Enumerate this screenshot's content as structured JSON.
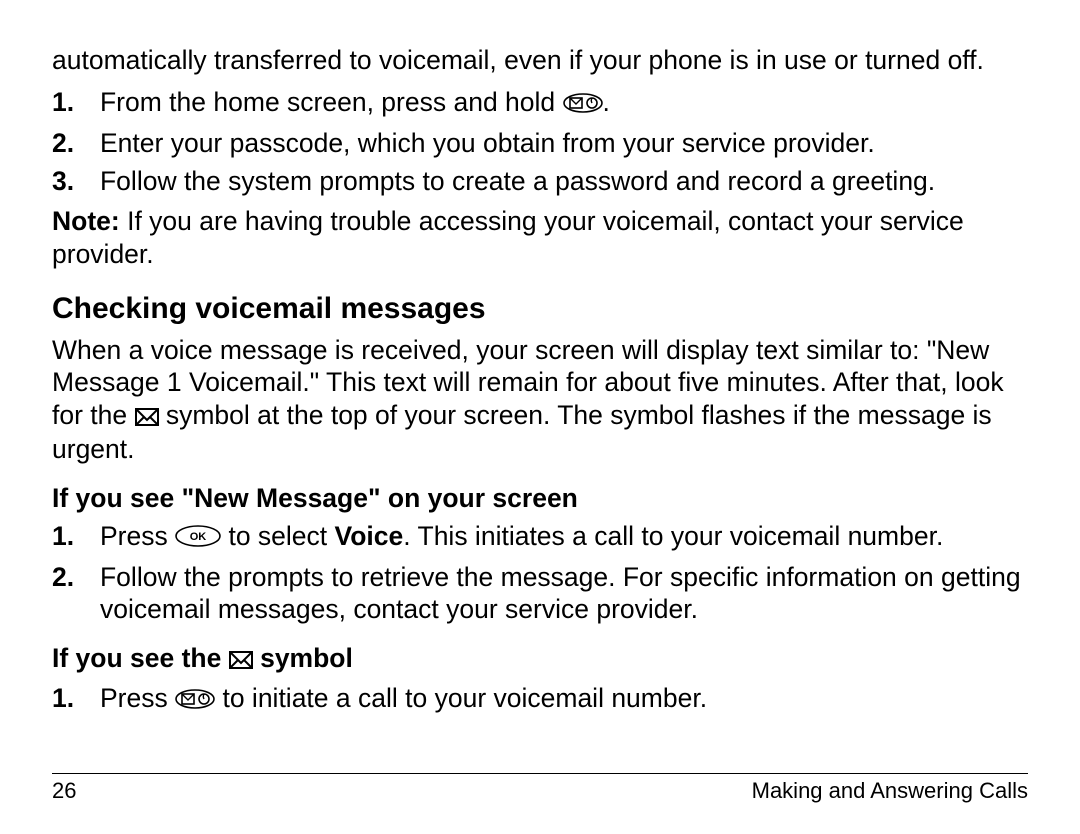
{
  "intro": "automatically transferred to voicemail, even if your phone is in use or turned off.",
  "setup_steps": [
    {
      "num": "1.",
      "before": "From the home screen, press and hold ",
      "icon": "voicemail-key-icon",
      "after": "."
    },
    {
      "num": "2.",
      "text": "Enter your passcode, which you obtain from your service provider."
    },
    {
      "num": "3.",
      "text": "Follow the system prompts to create a password and record a greeting."
    }
  ],
  "note": {
    "label": "Note:",
    "text": " If you are having trouble accessing your voicemail, contact your service provider."
  },
  "section_heading": "Checking voicemail messages",
  "section_body_a": "When a voice message is received, your screen will display text similar to: \"New Message 1 Voicemail.\" This text will remain for about five minutes. After that, look for the ",
  "section_body_b": " symbol at the top of your screen. The symbol flashes if the message is urgent.",
  "sub1_heading": "If you see \"New Message\" on your screen",
  "sub1_steps": [
    {
      "num": "1.",
      "before": "Press ",
      "icon": "ok-key-icon",
      "mid": " to select ",
      "bold": "Voice",
      "after": ". This initiates a call to your voicemail number."
    },
    {
      "num": "2.",
      "text": "Follow the prompts to retrieve the message. For specific information on getting voicemail messages, contact your service provider."
    }
  ],
  "sub2_heading_a": "If you see the ",
  "sub2_heading_b": " symbol",
  "sub2_steps": [
    {
      "num": "1.",
      "before": "Press ",
      "icon": "voicemail-key-icon",
      "after": " to initiate a call to your voicemail number."
    }
  ],
  "footer": {
    "page": "26",
    "title": "Making and Answering Calls"
  }
}
